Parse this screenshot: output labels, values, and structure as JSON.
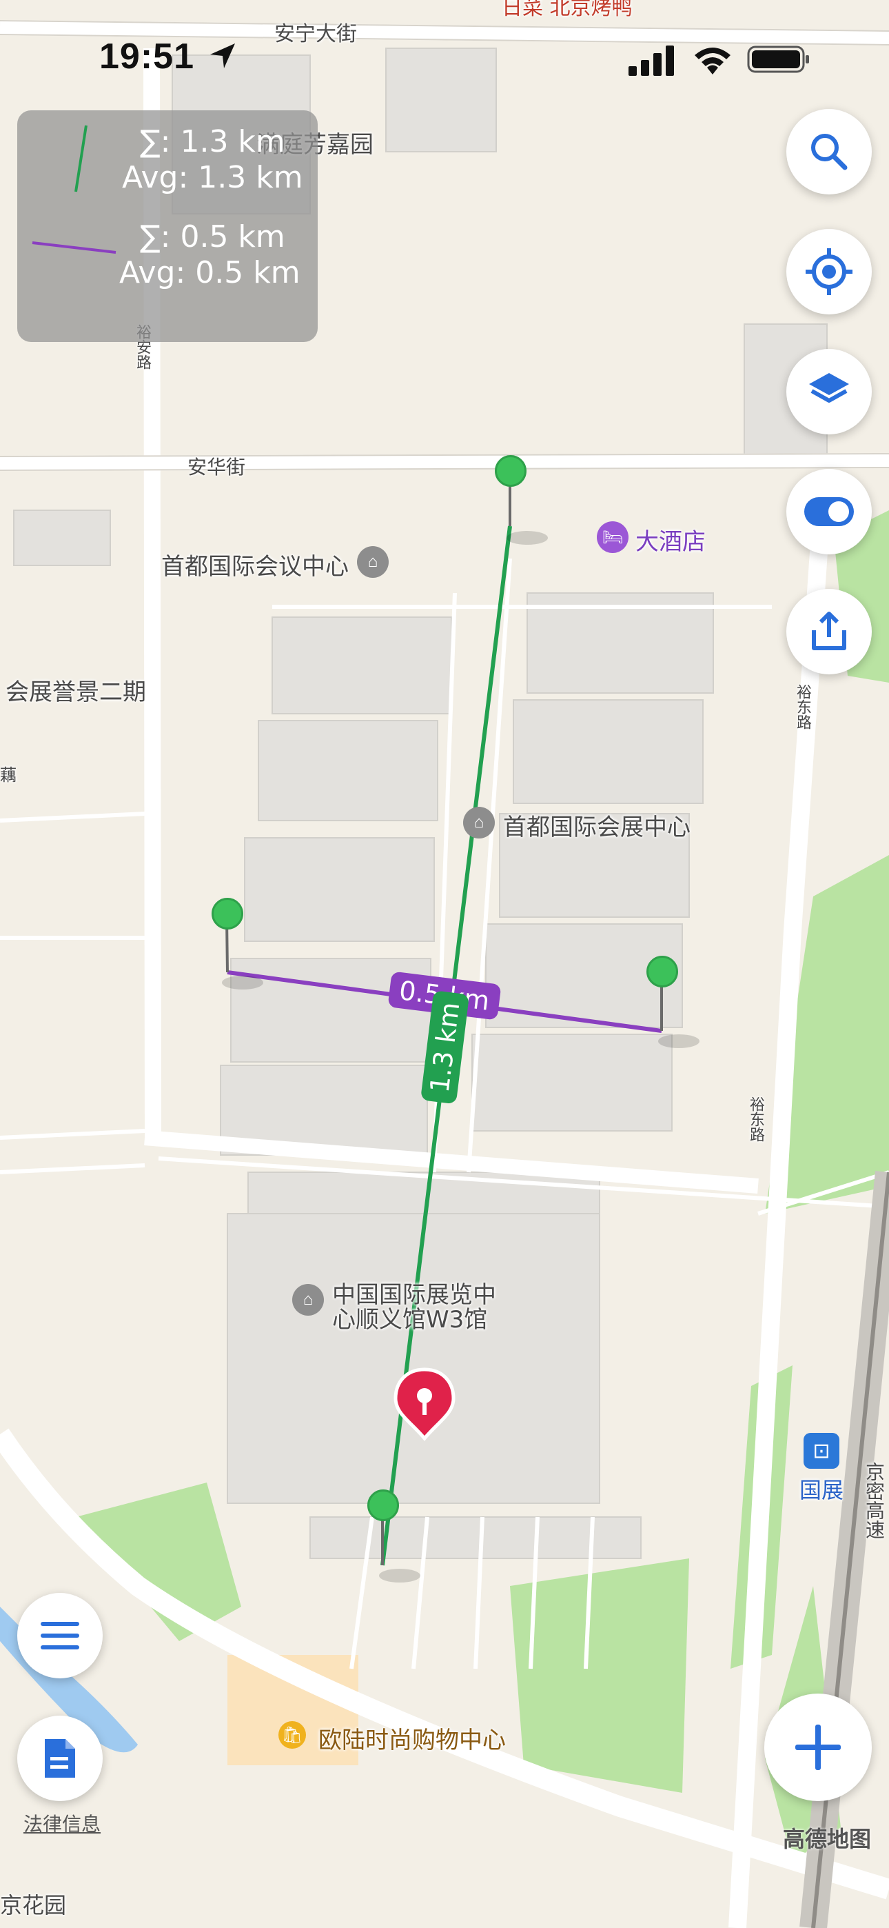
{
  "status_bar": {
    "time": "19:51"
  },
  "measurements": [
    {
      "sum": "∑: 1.3 km",
      "avg": "Avg: 1.3 km",
      "color": "#22a050",
      "label": "1.3 km"
    },
    {
      "sum": "∑: 0.5 km",
      "avg": "Avg: 0.5 km",
      "color": "#8a3fc0",
      "label": "0.5 km"
    }
  ],
  "map_labels": {
    "road_anning": "安宁大街",
    "top_cut": "日菜 北京烤鸭",
    "manting": "满庭芳嘉园",
    "yuan_lu": "裕安路",
    "anhua": "安华街",
    "hotel": "大酒店",
    "conference_center": "首都国际会议中心",
    "huizhan_jingjing": "会展誉景二期",
    "left_edge_road": "藕",
    "yudong_1": "裕东路",
    "yudong_2": "裕东路",
    "expo_center": "首都国际会展中心",
    "cn_expo_line1": "中国国际展览中",
    "cn_expo_line2": "心顺义馆W3馆",
    "guozhan": "国展",
    "jingmi": "京密高速",
    "mall": "欧陆时尚购物中心",
    "bottom_left": "京花园"
  },
  "legal_text": "法律信息",
  "brand_text": "高德地图",
  "icons": {
    "search": "search-icon",
    "locate": "crosshair-icon",
    "layers": "layers-icon",
    "toggle": "toggle-icon",
    "share": "share-icon",
    "menu": "menu-icon",
    "document": "document-icon",
    "add": "plus-icon"
  },
  "colors": {
    "accent": "#2a6fdb",
    "green_pin": "#3cc15a",
    "red_pin": "#e0224a"
  }
}
